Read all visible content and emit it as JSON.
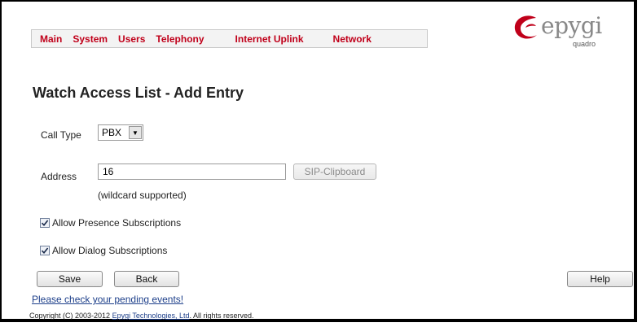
{
  "nav": {
    "items": [
      {
        "label": "Main"
      },
      {
        "label": "System"
      },
      {
        "label": "Users"
      },
      {
        "label": "Telephony"
      },
      {
        "label": "Internet Uplink"
      },
      {
        "label": "Network"
      }
    ]
  },
  "logo": {
    "word": "epygi",
    "sub": "quadro",
    "accent_color": "#c0001a"
  },
  "page": {
    "title": "Watch Access List - Add Entry"
  },
  "form": {
    "call_type_label": "Call Type",
    "call_type_value": "PBX",
    "address_label": "Address",
    "address_value": "16",
    "sip_clipboard_label": "SIP-Clipboard",
    "wildcard_note": "(wildcard supported)",
    "allow_presence_label": "Allow Presence Subscriptions",
    "allow_presence_checked": true,
    "allow_dialog_label": "Allow Dialog Subscriptions",
    "allow_dialog_checked": true
  },
  "buttons": {
    "save": "Save",
    "back": "Back",
    "help": "Help"
  },
  "footer": {
    "pending_events": "Please check your pending events!",
    "copyright_prefix": "Copyright (C) 2003-2012 ",
    "company_link": "Epygi Technologies, Ltd",
    "copyright_suffix": ". All rights reserved."
  }
}
